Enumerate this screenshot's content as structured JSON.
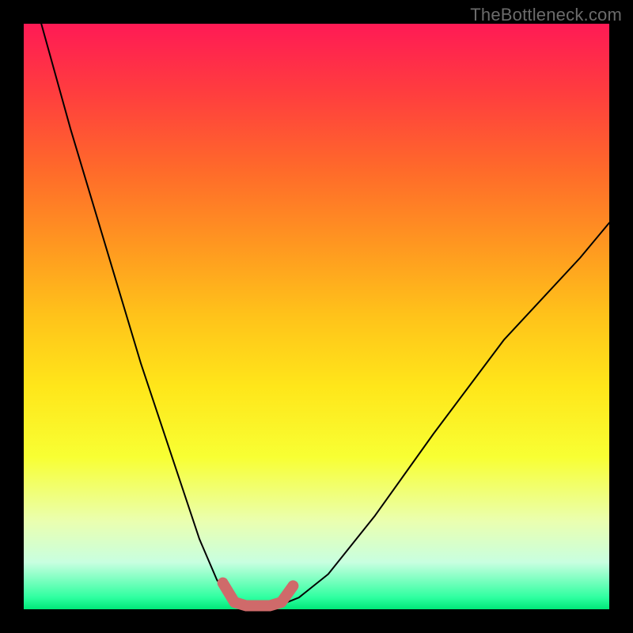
{
  "watermark": "TheBottleneck.com",
  "chart_data": {
    "type": "line",
    "title": "",
    "xlabel": "",
    "ylabel": "",
    "xlim": [
      0,
      100
    ],
    "ylim": [
      0,
      100
    ],
    "grid": false,
    "legend": false,
    "series": [
      {
        "name": "left-curve",
        "stroke": "#000000",
        "stroke_width": 2,
        "x": [
          3,
          8,
          14,
          20,
          26,
          30,
          33,
          35.5,
          37
        ],
        "y": [
          100,
          82,
          62,
          42,
          24,
          12,
          5,
          1.5,
          0.8
        ]
      },
      {
        "name": "right-curve",
        "stroke": "#000000",
        "stroke_width": 2,
        "x": [
          44,
          47,
          52,
          60,
          70,
          82,
          95,
          100
        ],
        "y": [
          0.8,
          2,
          6,
          16,
          30,
          46,
          60,
          66
        ]
      },
      {
        "name": "valley-highlight",
        "stroke": "#cf6a6a",
        "stroke_width": 14,
        "x": [
          34,
          36,
          38,
          40,
          42,
          44,
          46
        ],
        "y": [
          4.5,
          1.2,
          0.6,
          0.6,
          0.6,
          1.2,
          4.0
        ]
      }
    ],
    "annotations": []
  }
}
